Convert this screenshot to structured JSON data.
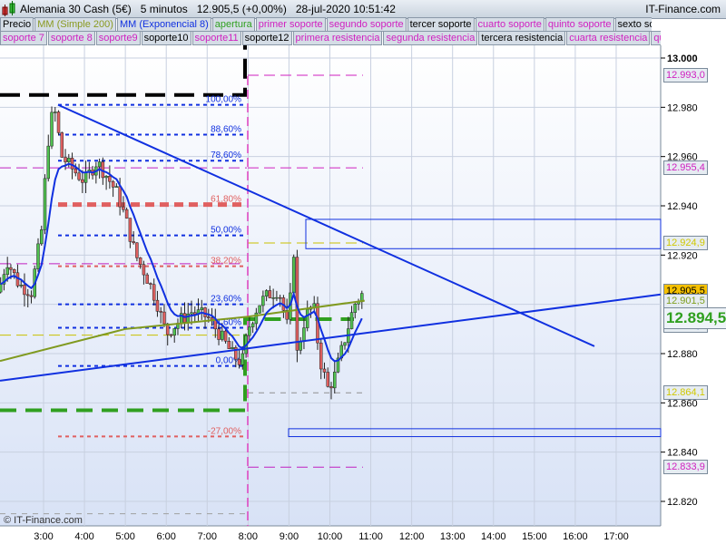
{
  "header": {
    "title": "Alemania 30 Cash (5€)   5 minutos   12.905,5 (+0,00%)   28-jul-2020 10:51:42",
    "brand": "IT-Finance.com"
  },
  "legend_row1": [
    {
      "t": "Precio",
      "c": "#000"
    },
    {
      "t": "MM (Simple 200)",
      "c": "#8a9a20"
    },
    {
      "t": "MM (Exponencial 8)",
      "c": "#1030e0"
    },
    {
      "t": "apertura",
      "c": "#30a020"
    },
    {
      "t": "primer soporte",
      "c": "#d020c0"
    },
    {
      "t": "segundo soporte",
      "c": "#d020c0"
    },
    {
      "t": "tercer soporte",
      "c": "#000"
    },
    {
      "t": "cuarto soporte",
      "c": "#d020c0"
    },
    {
      "t": "quinto soporte",
      "c": "#d020c0"
    },
    {
      "t": "sexto soporte",
      "c": "#000"
    }
  ],
  "legend_row2": [
    {
      "t": "soporte 7",
      "c": "#d020c0"
    },
    {
      "t": "soporte 8",
      "c": "#d020c0"
    },
    {
      "t": "soporte9",
      "c": "#d020c0"
    },
    {
      "t": "soporte10",
      "c": "#000"
    },
    {
      "t": "soporte11",
      "c": "#d020c0"
    },
    {
      "t": "soporte12",
      "c": "#000"
    },
    {
      "t": "primera resistencia",
      "c": "#d020c0"
    },
    {
      "t": "segunda resistencia",
      "c": "#d020c0"
    },
    {
      "t": "tercera resistencia",
      "c": "#000"
    },
    {
      "t": "cuarta resistencia",
      "c": "#d020c0"
    },
    {
      "t": "quinta",
      "c": "#d020c0"
    }
  ],
  "yticks": [
    "13.000",
    "12.980",
    "12.960",
    "12.940",
    "12.920",
    "12.880",
    "12.860",
    "12.840",
    "12.820"
  ],
  "ytick_values": [
    13000,
    12980,
    12960,
    12940,
    12920,
    12880,
    12860,
    12840,
    12820
  ],
  "xticks": [
    "3:00",
    "4:00",
    "5:00",
    "6:00",
    "7:00",
    "8:00",
    "9:00",
    "10:00",
    "11:00",
    "12:00",
    "13:00",
    "14:00",
    "15:00",
    "16:00",
    "17:00"
  ],
  "xtick_values": [
    3,
    4,
    5,
    6,
    7,
    8,
    9,
    10,
    11,
    12,
    13,
    14,
    15,
    16,
    17
  ],
  "price_labels": [
    {
      "t": "12.993,0",
      "v": 12993,
      "c": "#d020c0"
    },
    {
      "t": "12.955,4",
      "v": 12955.4,
      "c": "#d020c0"
    },
    {
      "t": "12.924,9",
      "v": 12924.9,
      "c": "#d0c800"
    },
    {
      "t": "12.905,5",
      "v": 12905.5,
      "c": "#000",
      "bg": "#f5c000"
    },
    {
      "t": "12.901,5",
      "v": 12901.5,
      "c": "#80a020"
    },
    {
      "t": "12.893,2",
      "v": 12891.5,
      "c": "#1030e0"
    },
    {
      "t": "12.864,1",
      "v": 12864.1,
      "c": "#d0c800"
    },
    {
      "t": "12.833,9",
      "v": 12833.9,
      "c": "#d020c0"
    }
  ],
  "current": {
    "t": "12.894,5",
    "v": 12894.5,
    "c": "#30a020"
  },
  "fib": {
    "high": 12981,
    "low": 12875,
    "levels": [
      {
        "p": 1,
        "t": "100,00%"
      },
      {
        "p": 0.886,
        "t": "88,60%"
      },
      {
        "p": 0.786,
        "t": "78,60%"
      },
      {
        "p": 0.618,
        "t": "61,80%",
        "red": true
      },
      {
        "p": 0.5,
        "t": "50,00%"
      },
      {
        "p": 0.382,
        "t": "38,20%",
        "red": true
      },
      {
        "p": 0.236,
        "t": "23,60%"
      },
      {
        "p": 0.146,
        "t": "14,60%"
      },
      {
        "p": 0,
        "t": "0,00%"
      },
      {
        "p": -0.27,
        "t": "-27,00%",
        "red": true
      }
    ]
  },
  "price_path": [
    [
      1.9,
      12905
    ],
    [
      2.1,
      12918
    ],
    [
      2.4,
      12908
    ],
    [
      2.7,
      12905
    ],
    [
      2.95,
      12930
    ],
    [
      3.1,
      12965
    ],
    [
      3.25,
      12981
    ],
    [
      3.45,
      12960
    ],
    [
      3.7,
      12955
    ],
    [
      4.0,
      12950
    ],
    [
      4.3,
      12958
    ],
    [
      4.55,
      12952
    ],
    [
      4.8,
      12945
    ],
    [
      5.0,
      12935
    ],
    [
      5.25,
      12920
    ],
    [
      5.5,
      12912
    ],
    [
      5.75,
      12902
    ],
    [
      6.0,
      12888
    ],
    [
      6.3,
      12893
    ],
    [
      6.6,
      12897
    ],
    [
      7.0,
      12895
    ],
    [
      7.3,
      12888
    ],
    [
      7.6,
      12880
    ],
    [
      7.85,
      12876
    ],
    [
      8.0,
      12890
    ],
    [
      8.25,
      12900
    ],
    [
      8.5,
      12904
    ],
    [
      8.75,
      12906
    ],
    [
      9.0,
      12888
    ],
    [
      9.1,
      12930
    ],
    [
      9.2,
      12880
    ],
    [
      9.4,
      12895
    ],
    [
      9.6,
      12900
    ],
    [
      9.75,
      12878
    ],
    [
      9.95,
      12866
    ],
    [
      10.1,
      12870
    ],
    [
      10.35,
      12885
    ],
    [
      10.6,
      12900
    ],
    [
      10.85,
      12905.5
    ]
  ],
  "sma200": [
    [
      1.9,
      12877
    ],
    [
      5,
      12890
    ],
    [
      8,
      12895
    ],
    [
      10.85,
      12901.5
    ]
  ],
  "watermark": "© IT-Finance.com"
}
